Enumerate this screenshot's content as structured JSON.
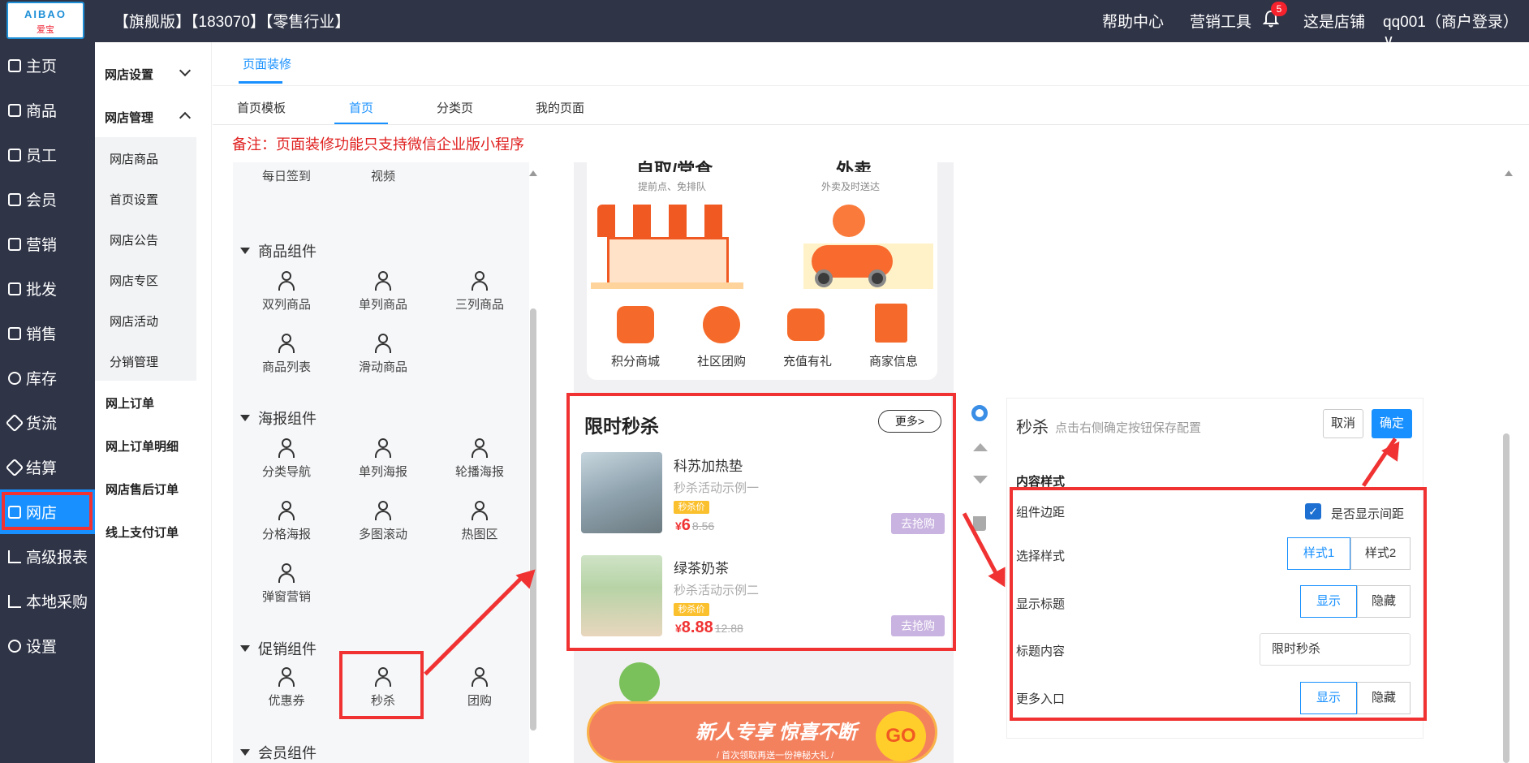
{
  "topbar": {
    "logo_text": "AIBAO",
    "logo_sub": "爱宝",
    "shop_title": "【旗舰版】【183070】【零售行业】",
    "nav": [
      "帮助中心",
      "营销工具"
    ],
    "notification_count": "5",
    "store_link": "这是店铺",
    "user": "qq001（商户登录）"
  },
  "leftnav": {
    "items": [
      "主页",
      "商品",
      "员工",
      "会员",
      "营销",
      "批发",
      "销售",
      "库存",
      "货流",
      "结算",
      "网店",
      "高级报表",
      "本地采购",
      "设置"
    ],
    "active": "网店"
  },
  "subnav": {
    "groups": [
      "网店设置",
      "网店管理"
    ],
    "items": [
      "网店商品",
      "首页设置",
      "网店公告",
      "网店专区",
      "网店活动",
      "分销管理"
    ],
    "links": [
      "网上订单",
      "网上订单明细",
      "网店售后订单",
      "线上支付订单"
    ]
  },
  "tabs": {
    "main": "页面装修",
    "sub": [
      "首页模板",
      "首页",
      "分类页",
      "我的页面"
    ],
    "active_sub": "首页"
  },
  "note": "备注：页面装修功能只支持微信企业版小程序",
  "components": {
    "top_items": [
      "每日签到",
      "视频"
    ],
    "groups": [
      {
        "title": "商品组件",
        "items": [
          "双列商品",
          "单列商品",
          "三列商品",
          "商品列表",
          "滑动商品"
        ]
      },
      {
        "title": "海报组件",
        "items": [
          "分类导航",
          "单列海报",
          "轮播海报",
          "分格海报",
          "多图滚动",
          "热图区",
          "弹窗营销"
        ]
      },
      {
        "title": "促销组件",
        "items": [
          "优惠券",
          "秒杀",
          "团购"
        ]
      },
      {
        "title": "会员组件",
        "items": []
      }
    ]
  },
  "preview": {
    "entries": [
      {
        "title": "自取/堂食",
        "sub": "提前点、免排队"
      },
      {
        "title": "外卖",
        "sub": "外卖及时送达"
      }
    ],
    "features": [
      "积分商城",
      "社区团购",
      "充值有礼",
      "商家信息"
    ],
    "seckill": {
      "title": "限时秒杀",
      "more": "更多>",
      "products": [
        {
          "name": "科苏加热垫",
          "desc": "秒杀活动示例一",
          "tag": "秒杀价",
          "currency": "¥",
          "price": "6",
          "old": "8.56",
          "buy": "去抢购"
        },
        {
          "name": "绿茶奶茶",
          "desc": "秒杀活动示例二",
          "tag": "秒杀价",
          "currency": "¥",
          "price": "8.88",
          "old": "12.88",
          "buy": "去抢购"
        }
      ]
    },
    "banner": {
      "text": "新人专享 惊喜不断",
      "small": "/ 首次领取再送一份神秘大礼 /",
      "go": "GO"
    }
  },
  "config": {
    "title": "秒杀",
    "tip": "点击右侧确定按钮保存配置",
    "cancel": "取消",
    "ok": "确定",
    "section": "内容样式",
    "rows": {
      "margin_label": "组件边距",
      "margin_check": "是否显示间距",
      "style_label": "选择样式",
      "style_opts": [
        "样式1",
        "样式2"
      ],
      "show_title_label": "显示标题",
      "show_title_opts": [
        "显示",
        "隐藏"
      ],
      "title_content_label": "标题内容",
      "title_content_value": "限时秒杀",
      "more_label": "更多入口",
      "more_opts": [
        "显示",
        "隐藏"
      ]
    }
  },
  "colors": {
    "nav_bg": "#2f3447",
    "accent": "#1890ff",
    "highlight": "#f03232"
  }
}
